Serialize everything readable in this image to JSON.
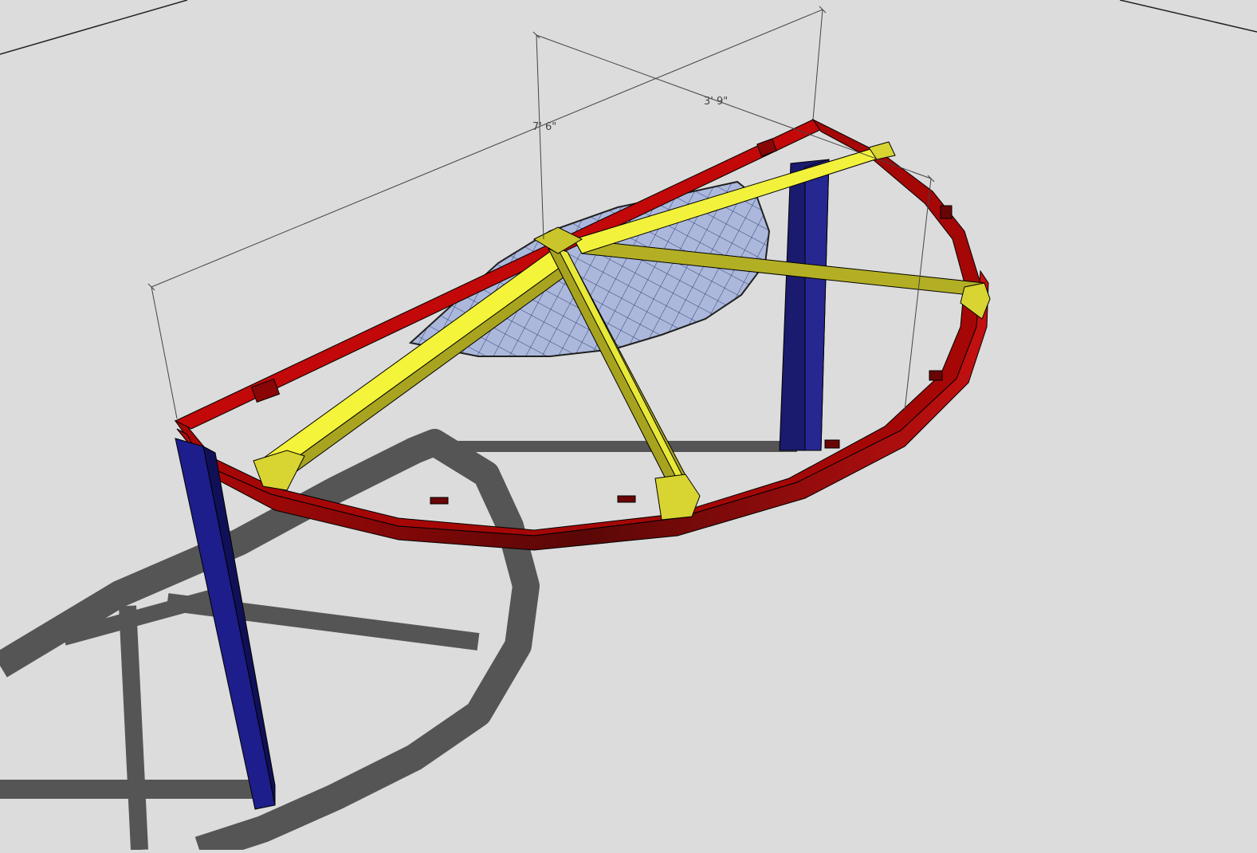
{
  "scene": {
    "description_free": true,
    "dimensions": [
      {
        "id": "width",
        "label": "7' 6\""
      },
      {
        "id": "depth",
        "label": "3' 9\""
      }
    ]
  },
  "colors": {
    "background": "#dcdcdc",
    "shadow": "#545454",
    "rim_top": "#c10505",
    "rim_side": "#7a0a0a",
    "legs": "#1c1c8a",
    "spokes_light": "#f5f53a",
    "spokes_dark": "#a8a420",
    "mesh": "#9fb0d8",
    "mesh_lines": "#2a3560",
    "dimension_lines": "#444444"
  },
  "icons": {
    "model": "semi-circular-table-frame-3d-model"
  }
}
